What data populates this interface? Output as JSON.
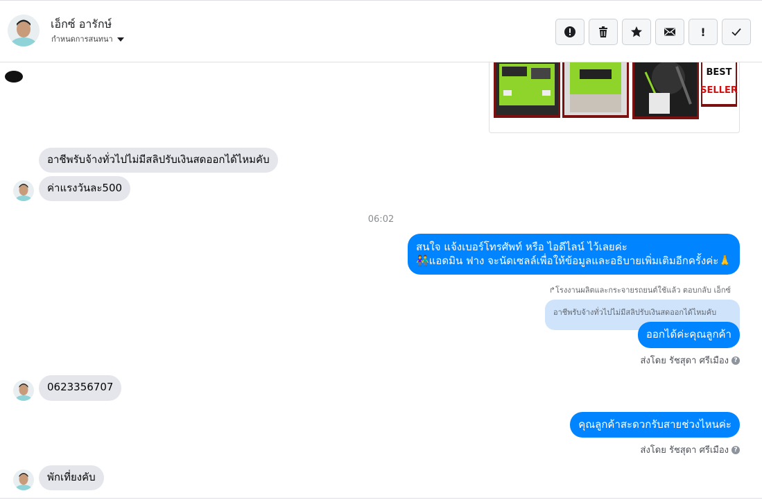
{
  "header": {
    "name": "เอ็กซ์ อารักษ์",
    "subtitle": "กำหนดการสนทนา",
    "actions": [
      {
        "icon": "alert-circle-icon"
      },
      {
        "icon": "trash-icon"
      },
      {
        "icon": "star-icon"
      },
      {
        "icon": "envelope-icon"
      },
      {
        "label": "!"
      },
      {
        "icon": "checkmark-icon"
      }
    ]
  },
  "link_card": {
    "badge_line1": "BEST",
    "badge_line2": "SELLER"
  },
  "messages": {
    "in1": "อาชีพรับจ้างทั่วไปไม่มีสลิปรับเงินสดออกได้ไหมคับ",
    "in2": "ค่าแรงวันละ500",
    "timestamp": "06:02",
    "out1_line1": "สนใจ แจ้งเบอร์โทรศัพท์ หรือ ไอดีไลน์  ไว้เลยค่ะ",
    "out1_line2": "👫แอดมิน ฟาง จะนัดเซลล์เพื่อให้ข้อมูลและอธิบายเพิ่มเติมอีกครั้งค่ะ🙏",
    "reply_note": "↱โรงงานผลิตและกระจายรถยนต์ใช้แล้ว ตอบกลับ เอ็กซ์",
    "quoted": "อาชีพรับจ้างทั่วไปไม่มีสลิปรับเงินสดออกได้ไหมคับ",
    "out2": "ออกได้ค่ะคุณลูกค้า",
    "sent_by1": "ส่งโดย รัชสุดา ศรีเมือง",
    "in3": "0623356707",
    "out3": "คุณลูกค้าสะดวกรับสายช่วงไหนค่ะ",
    "sent_by2": "ส่งโดย รัชสุดา ศรีเมือง",
    "in4": "พักเที่ยงคับ"
  },
  "colors": {
    "outgoing": "#0084ff",
    "incoming": "#e4e6eb",
    "quoted": "#cfe3fb",
    "car_green": "#8fd42a"
  }
}
